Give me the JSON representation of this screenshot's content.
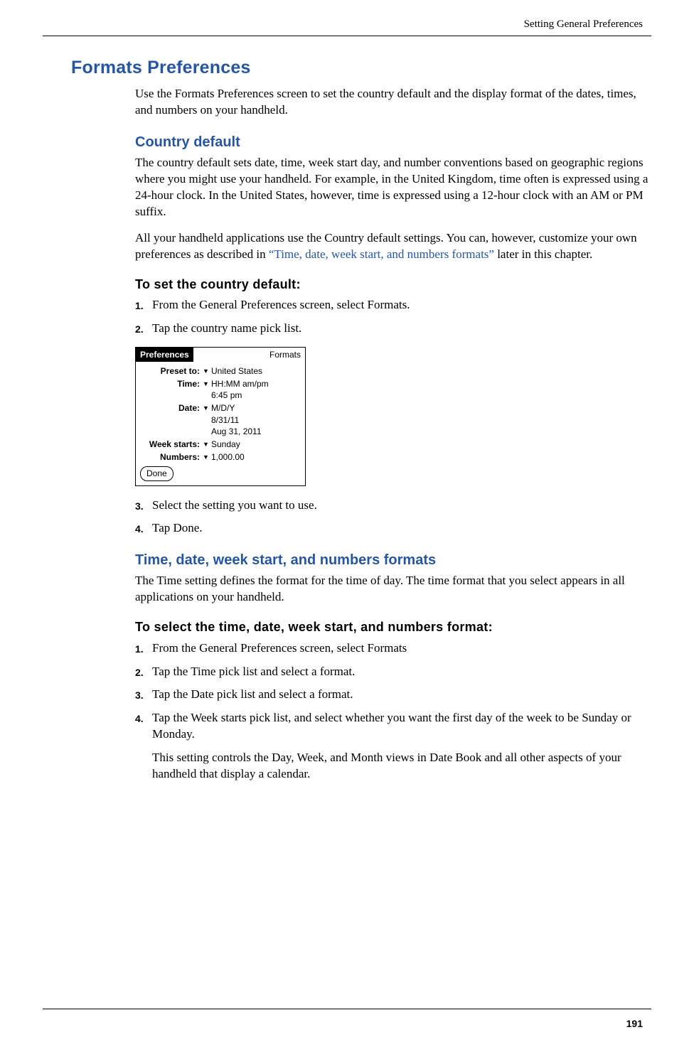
{
  "runningHead": "Setting General Preferences",
  "pageNumber": "191",
  "section": {
    "title": "Formats Preferences",
    "intro": "Use the Formats Preferences screen to set the country default and the display format of the dates, times, and numbers on your handheld."
  },
  "countryDefault": {
    "heading": "Country default",
    "para1": "The country default sets date, time, week start day, and number conventions based on geographic regions where you might use your handheld. For example, in the United Kingdom, time often is expressed using a 24-hour clock. In the United States, however, time is expressed using a 12-hour clock with an AM or PM suffix.",
    "para2a": "All your handheld applications use the Country default settings. You can, however, customize your own preferences as described in ",
    "para2link": "“Time, date, week start, and numbers formats”",
    "para2b": " later in this chapter.",
    "procHeading": "To set the country default:",
    "steps": [
      {
        "num": "1.",
        "text": "From the General Preferences screen, select Formats."
      },
      {
        "num": "2.",
        "text": "Tap the country name pick list."
      },
      {
        "num": "3.",
        "text": "Select the setting you want to use."
      },
      {
        "num": "4.",
        "text": "Tap Done."
      }
    ]
  },
  "device": {
    "title": "Preferences",
    "corner": "Formats",
    "presetLabel": "Preset to:",
    "presetValue": "United States",
    "timeLabel": "Time:",
    "timeValue": "HH:MM am/pm",
    "timeExample": "6:45 pm",
    "dateLabel": "Date:",
    "dateValue": "M/D/Y",
    "dateExample1": "8/31/11",
    "dateExample2": "Aug 31, 2011",
    "weekLabel": "Week starts:",
    "weekValue": "Sunday",
    "numbersLabel": "Numbers:",
    "numbersValue": "1,000.00",
    "doneLabel": "Done"
  },
  "timeFormats": {
    "heading": "Time, date, week start, and numbers formats",
    "para": "The Time setting defines the format for the time of day. The time format that you select appears in all applications on your handheld.",
    "procHeading": "To select the time, date, week start, and numbers format:",
    "steps": [
      {
        "num": "1.",
        "text": "From the General Preferences screen, select Formats"
      },
      {
        "num": "2.",
        "text": "Tap the Time pick list and select a format."
      },
      {
        "num": "3.",
        "text": "Tap the Date pick list and select a format."
      },
      {
        "num": "4.",
        "text": "Tap the Week starts pick list, and select whether you want the first day of the week to be Sunday or Monday.",
        "extra": "This setting controls the Day, Week, and Month views in Date Book and all other aspects of your handheld that display a calendar."
      }
    ]
  }
}
